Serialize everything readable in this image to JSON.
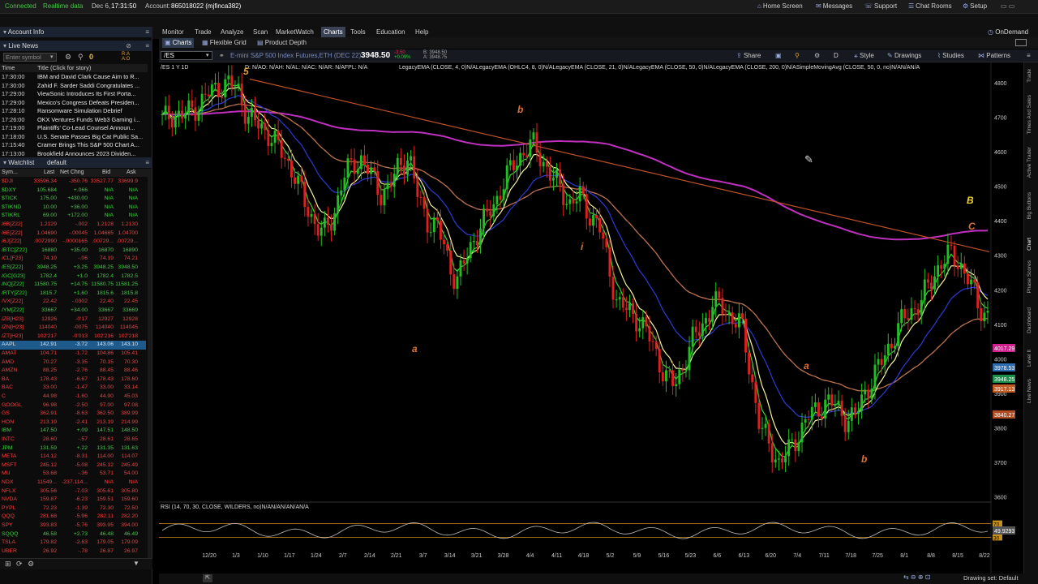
{
  "status": {
    "connected": "Connected",
    "realtime": "Realtime data",
    "date": "Dec 6,",
    "time": "17:31:50",
    "account_label": "Account:",
    "account": "865018022 (mjfinca382)",
    "links": [
      "Home Screen",
      "Messages",
      "Support",
      "Chat Rooms",
      "Setup"
    ]
  },
  "left": {
    "account_info": "Account Info",
    "live_news": "Live News",
    "enter_symbol_placeholder": "Enter symbol",
    "news_count": "0",
    "news_cols": {
      "time": "Time",
      "title": "Title (Click for story)"
    },
    "news": [
      {
        "t": "17:30:00",
        "h": "IBM and David Clark Cause Aim to R..."
      },
      {
        "t": "17:30:00",
        "h": "Zahid F. Sarder Saddi Congratulates ..."
      },
      {
        "t": "17:29:00",
        "h": "ViewSonic Introduces Its First Porta..."
      },
      {
        "t": "17:29:00",
        "h": "Mexico's Congress Defeats Presiden..."
      },
      {
        "t": "17:28:10",
        "h": "Ransomware Simulation Debrief"
      },
      {
        "t": "17:26:00",
        "h": "OKX Ventures Funds Web3 Gaming i..."
      },
      {
        "t": "17:19:00",
        "h": "Plaintiffs' Co-Lead Counsel Announ..."
      },
      {
        "t": "17:18:00",
        "h": "U.S. Senate Passes Big Cat Public Sa..."
      },
      {
        "t": "17:15:40",
        "h": "Cramer Brings This S&P 500 Chart A..."
      },
      {
        "t": "17:13:00",
        "h": "Brookfield Announces 2023 Dividen..."
      }
    ],
    "watchlist_label": "Watchlist",
    "watchlist_name": "default",
    "wl_cols": {
      "sym": "Sym...",
      "last": "Last",
      "chg": "Net Chng",
      "bid": "Bid",
      "ask": "Ask"
    },
    "watchlist": [
      {
        "s": "$DJI",
        "l": "33596.34",
        "c": "-350.76",
        "b": "33527.77",
        "a": "33699.9",
        "up": false
      },
      {
        "s": "$DXY",
        "l": "105.684",
        "c": "+.066",
        "b": "N/A",
        "a": "N/A",
        "up": true
      },
      {
        "s": "$TICK",
        "l": "175.00",
        "c": "+430.00",
        "b": "N/A",
        "a": "N/A",
        "up": true
      },
      {
        "s": "$TIKND",
        "l": "10.00",
        "c": "+36.00",
        "b": "N/A",
        "a": "N/A",
        "up": true
      },
      {
        "s": "$TIKRL",
        "l": "69.00",
        "c": "+172.00",
        "b": "N/A",
        "a": "N/A",
        "up": true
      },
      {
        "s": "/6B[Z22]",
        "l": "1.2129",
        "c": "-.002",
        "b": "1.2128",
        "a": "1.2130",
        "up": false
      },
      {
        "s": "/6E[Z22]",
        "l": "1.04690",
        "c": "-.00045",
        "b": "1.04685",
        "a": "1.04700",
        "up": false
      },
      {
        "s": "/6J[Z22]",
        "l": ".0072990",
        "c": "-.0000165",
        "b": ".00729...",
        "a": ".00729...",
        "up": false
      },
      {
        "s": "/BTC[Z22]",
        "l": "16880",
        "c": "+35.00",
        "b": "16870",
        "a": "16890",
        "up": true
      },
      {
        "s": "/CL[F23]",
        "l": "74.19",
        "c": "-.06",
        "b": "74.19",
        "a": "74.21",
        "up": false
      },
      {
        "s": "/ES[Z22]",
        "l": "3948.25",
        "c": "+3.25",
        "b": "3948.25",
        "a": "3948.50",
        "up": true
      },
      {
        "s": "/GC[G23]",
        "l": "1782.4",
        "c": "+1.0",
        "b": "1782.4",
        "a": "1782.5",
        "up": true
      },
      {
        "s": "/NQ[Z22]",
        "l": "11580.75",
        "c": "+14.75",
        "b": "11580.75",
        "a": "11581.25",
        "up": true
      },
      {
        "s": "/RTY[Z22]",
        "l": "1815.7",
        "c": "+1.60",
        "b": "1815.6",
        "a": "1815.8",
        "up": true
      },
      {
        "s": "/VX[Z22]",
        "l": "22.42",
        "c": "-.0302",
        "b": "22.40",
        "a": "22.45",
        "up": false
      },
      {
        "s": "/YM[Z22]",
        "l": "33667",
        "c": "+34.00",
        "b": "33667",
        "a": "33669",
        "up": true
      },
      {
        "s": "/ZB[H23]",
        "l": "12926",
        "c": "-0'17",
        "b": "12927",
        "a": "12928",
        "up": false
      },
      {
        "s": "/ZN[H23]",
        "l": "114040",
        "c": "-0075",
        "b": "114040",
        "a": "114045",
        "up": false
      },
      {
        "s": "/ZT[H23]",
        "l": "102'217",
        "c": "-0'013",
        "b": "102'216",
        "a": "102'218",
        "up": false
      },
      {
        "s": "AAPL",
        "l": "142.91",
        "c": "-3.72",
        "b": "143.06",
        "a": "143.10",
        "up": false,
        "sel": true
      },
      {
        "s": "AMAT",
        "l": "104.71",
        "c": "-1.72",
        "b": "104.86",
        "a": "105.41",
        "up": false
      },
      {
        "s": "AMD",
        "l": "70.27",
        "c": "-3.35",
        "b": "70.15",
        "a": "70.30",
        "up": false
      },
      {
        "s": "AMZN",
        "l": "88.25",
        "c": "-2.76",
        "b": "88.45",
        "a": "88.46",
        "up": false
      },
      {
        "s": "BA",
        "l": "178.43",
        "c": "-6.67",
        "b": "178.43",
        "a": "178.60",
        "up": false
      },
      {
        "s": "BAC",
        "l": "33.00",
        "c": "-1.47",
        "b": "33.00",
        "a": "33.14",
        "up": false
      },
      {
        "s": "C",
        "l": "44.98",
        "c": "-1.60",
        "b": "44.90",
        "a": "45.03",
        "up": false
      },
      {
        "s": "GOOGL",
        "l": "96.98",
        "c": "-2.50",
        "b": "97.00",
        "a": "97.08",
        "up": false
      },
      {
        "s": "GS",
        "l": "362.91",
        "c": "-8.63",
        "b": "362.50",
        "a": "389.99",
        "up": false
      },
      {
        "s": "HON",
        "l": "213.19",
        "c": "-2.41",
        "b": "213.19",
        "a": "214.99",
        "up": false
      },
      {
        "s": "IBM",
        "l": "147.50",
        "c": "+.09",
        "b": "147.51",
        "a": "148.50",
        "up": true
      },
      {
        "s": "INTC",
        "l": "28.60",
        "c": "-.57",
        "b": "28.61",
        "a": "28.65",
        "up": false
      },
      {
        "s": "JPM",
        "l": "131.59",
        "c": "+.22",
        "b": "131.35",
        "a": "131.63",
        "up": true
      },
      {
        "s": "META",
        "l": "114.12",
        "c": "-8.31",
        "b": "114.00",
        "a": "114.07",
        "up": false
      },
      {
        "s": "MSFT",
        "l": "245.12",
        "c": "-5.08",
        "b": "245.12",
        "a": "245.49",
        "up": false
      },
      {
        "s": "MU",
        "l": "53.68",
        "c": "-.36",
        "b": "53.71",
        "a": "54.00",
        "up": false
      },
      {
        "s": "NDX",
        "l": "11549...",
        "c": "-237.114...",
        "b": "N/A",
        "a": "N/A",
        "up": false
      },
      {
        "s": "NFLX",
        "l": "305.56",
        "c": "-7.03",
        "b": "305.61",
        "a": "305.80",
        "up": false
      },
      {
        "s": "NVDA",
        "l": "159.87",
        "c": "-6.23",
        "b": "159.51",
        "a": "159.60",
        "up": false
      },
      {
        "s": "PYPL",
        "l": "72.23",
        "c": "-1.39",
        "b": "72.30",
        "a": "72.50",
        "up": false
      },
      {
        "s": "QQQ",
        "l": "281.68",
        "c": "-5.96",
        "b": "282.11",
        "a": "282.20",
        "up": false
      },
      {
        "s": "SPY",
        "l": "393.83",
        "c": "-5.76",
        "b": "393.95",
        "a": "394.00",
        "up": false
      },
      {
        "s": "SQQQ",
        "l": "46.58",
        "c": "+2.73",
        "b": "46.48",
        "a": "46.49",
        "up": true
      },
      {
        "s": "TSLA",
        "l": "179.82",
        "c": "-2.63",
        "b": "179.05",
        "a": "179.09",
        "up": false
      },
      {
        "s": "UBER",
        "l": "26.92",
        "c": "-.78",
        "b": "26.87",
        "a": "26.97",
        "up": false
      }
    ]
  },
  "menu": [
    "Monitor",
    "Trade",
    "Analyze",
    "Scan",
    "MarketWatch",
    "Charts",
    "Tools",
    "Education",
    "Help"
  ],
  "menu_active": "Charts",
  "ondemand": "OnDemand",
  "subtabs": [
    "Charts",
    "Flexible Grid",
    "Product Depth"
  ],
  "toolbar": {
    "symbol": "/ES",
    "description": "E-mini S&P 500 Index Futures,ETH (DEC 22)",
    "price": "3948.50",
    "change": "-3.50",
    "change_pct": "+0.09%",
    "bid": "B: 3948.50",
    "ask": "A: 3948.75",
    "buttons": [
      "Share",
      "D",
      "Style",
      "Drawings",
      "Studies",
      "Patterns"
    ]
  },
  "chart_header": {
    "left": "/ES 1 Y 1D",
    "info": "D: N/AO: N/AH: N/AL: N/AC: N/AR: N/AFPL: N/A",
    "studies": "LegacyEMA (CLOSE, 4, 0)N/ALegacyEMA (OHLC4, 8, 0)N/ALegacyEMA (CLOSE, 21, 0)N/ALegacyEMA (CLOSE, 50, 0)N/ALegacyEMA (CLOSE, 200, 0)N/ASimpleMovingAvg (CLOSE, 50, 0, no)N/AN/AN/A"
  },
  "chart_data": {
    "type": "candlestick",
    "symbol": "/ES",
    "y_ticks": [
      3600,
      3700,
      3800,
      3900,
      4000,
      4100,
      4200,
      4300,
      4400,
      4500,
      4600,
      4700,
      4800
    ],
    "ylim": [
      3590,
      4830
    ],
    "x_ticks": [
      "12/20",
      "1/3",
      "1/10",
      "1/17",
      "1/24",
      "2/7",
      "2/14",
      "2/21",
      "3/7",
      "3/14",
      "3/21",
      "3/28",
      "4/4",
      "4/11",
      "4/18",
      "5/2",
      "5/9",
      "5/16",
      "5/23",
      "6/6",
      "6/13",
      "6/20",
      "7/4",
      "7/11",
      "7/18",
      "7/25",
      "8/1",
      "8/8",
      "8/15",
      "8/22"
    ],
    "closes": [
      4690,
      4710,
      4700,
      4720,
      4740,
      4770,
      4790,
      4795,
      4780,
      4700,
      4680,
      4660,
      4620,
      4580,
      4530,
      4450,
      4400,
      4360,
      4410,
      4520,
      4560,
      4580,
      4530,
      4480,
      4500,
      4560,
      4590,
      4460,
      4400,
      4380,
      4300,
      4220,
      4290,
      4360,
      4400,
      4450,
      4510,
      4560,
      4600,
      4620,
      4580,
      4530,
      4490,
      4450,
      4470,
      4420,
      4390,
      4270,
      4160,
      4140,
      4120,
      4080,
      4020,
      3950,
      3920,
      3990,
      4060,
      4100,
      4160,
      4150,
      4120,
      4100,
      3960,
      3800,
      3750,
      3700,
      3730,
      3780,
      3830,
      3850,
      3880,
      3860,
      3830,
      3830,
      3900,
      3950,
      4000,
      4060,
      4110,
      4140,
      4170,
      4220,
      4280,
      4300,
      4280,
      4230,
      4150,
      4130
    ],
    "labels": [
      {
        "text": "5",
        "color": "#e0a030"
      },
      {
        "text": "b",
        "color": "#e07030"
      },
      {
        "text": "i",
        "color": "#e07030"
      },
      {
        "text": "a",
        "color": "#e07030"
      },
      {
        "text": "B",
        "color": "#f0d020"
      },
      {
        "text": "C",
        "color": "#e07030"
      },
      {
        "text": "a",
        "color": "#e07030"
      },
      {
        "text": "b",
        "color": "#e07030"
      }
    ],
    "price_tags": [
      {
        "text": "4017.29",
        "color": "#d0208e"
      },
      {
        "text": "3978.53",
        "color": "#2b6bb0"
      },
      {
        "text": "3948.25",
        "color": "#1a8f4a"
      },
      {
        "text": "3917.13",
        "color": "#c05a20"
      },
      {
        "text": "3840.27",
        "color": "#b04a20"
      }
    ]
  },
  "rsi": {
    "label": "RSI (14, 70, 30, CLOSE, WILDERS, no)N/AN/AN/AN/AN/A",
    "value_tag": "49.9293",
    "levels": {
      "overbought": "70",
      "oversold": "30"
    }
  },
  "right_tabs": [
    "Trade",
    "Times And Sales",
    "Active Trader",
    "Big Buttons",
    "Chart",
    "Phase Scores",
    "Dashboard",
    "Level II",
    "Live News"
  ],
  "footer": {
    "drawing_set": "Drawing set: Default"
  },
  "colors": {
    "ema4": "#3ad43a",
    "ema8": "#f4f4a0",
    "ema21": "#2b3bd8",
    "ema50": "#b87050",
    "ema200": "#c030c0",
    "sma50": "#b86a40",
    "trendline": "#c05028",
    "candle_up": "#20c020",
    "candle_down": "#e02020"
  }
}
